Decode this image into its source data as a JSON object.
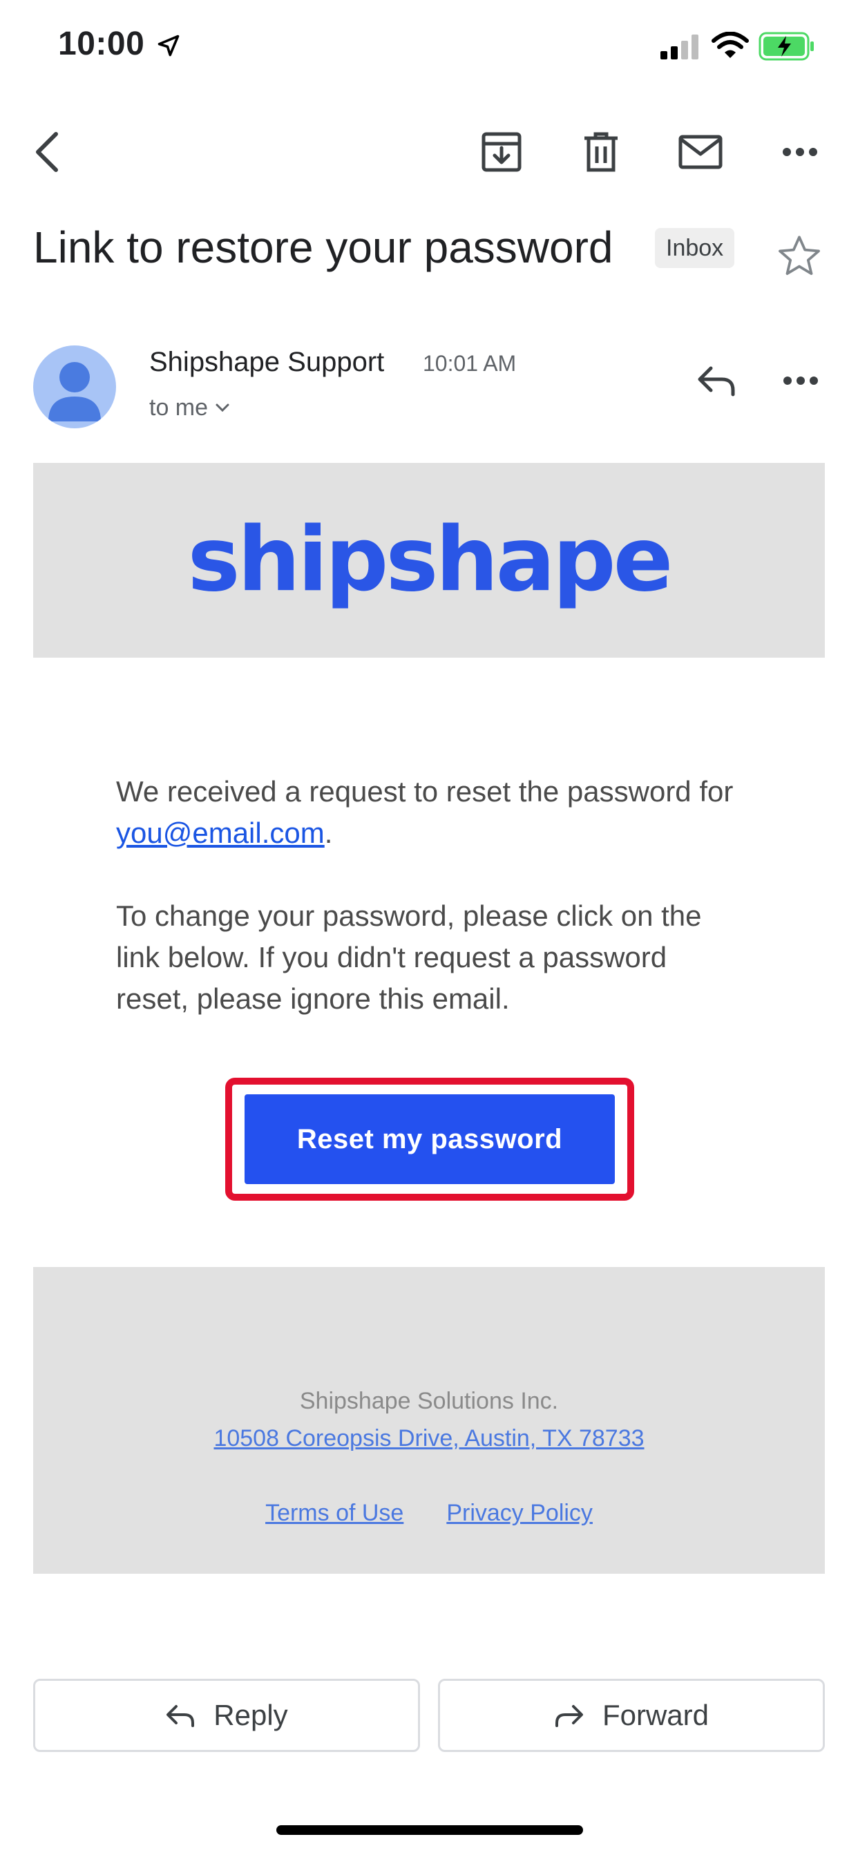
{
  "status_bar": {
    "time": "10:00",
    "icons": [
      "location-arrow-icon",
      "cellular-signal-icon",
      "wifi-icon",
      "battery-charging-icon"
    ],
    "battery_color": "#4cd964"
  },
  "toolbar": {
    "icons": [
      "back-icon",
      "archive-icon",
      "delete-icon",
      "mark-unread-icon",
      "more-icon"
    ]
  },
  "email": {
    "subject": "Link to restore your password",
    "label": "Inbox",
    "sender": "Shipshape Support",
    "time": "10:01 AM",
    "recipient": "to me"
  },
  "body": {
    "brand": "shipshape",
    "p1_text": "We received a request to reset the password for ",
    "p1_link": "you@email.com",
    "p1_end": ".",
    "p2": "To change your password, please click on the link below. If you didn't request a password reset, please ignore this email.",
    "cta": "Reset my password"
  },
  "footer": {
    "company": "Shipshape Solutions Inc.",
    "address": "10508 Coreopsis Drive, Austin, TX 78733",
    "terms": "Terms of Use",
    "privacy": "Privacy Policy"
  },
  "actions": {
    "reply": "Reply",
    "forward": "Forward"
  },
  "colors": {
    "brand": "#2a56e6",
    "cta": "#2451ef",
    "highlight": "#e3102f",
    "link": "#1a55e3"
  }
}
